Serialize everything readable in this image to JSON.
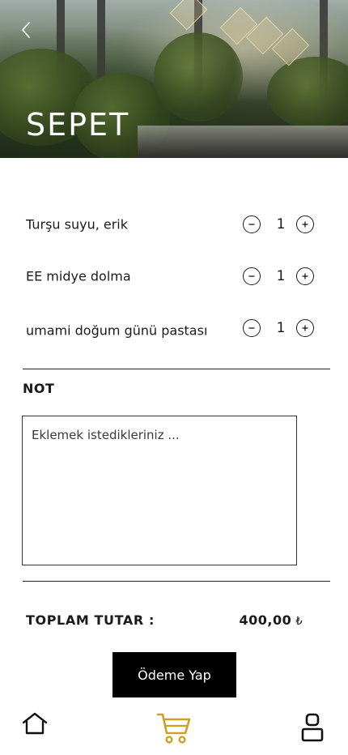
{
  "header": {
    "title": "SEPET"
  },
  "cart": {
    "items": [
      {
        "name": "Turşu suyu, erik",
        "quantity": "1"
      },
      {
        "name": "EE midye dolma",
        "quantity": "1"
      },
      {
        "name": "umami doğum günü pastası",
        "quantity": "1"
      }
    ]
  },
  "note": {
    "label": "NOT",
    "placeholder": "Eklemek istedikleriniz ...",
    "value": ""
  },
  "total": {
    "label": "TOPLAM TUTAR :",
    "amount": "400,00",
    "currency": "₺"
  },
  "actions": {
    "pay_label": "Ödeme Yap"
  },
  "bottom_nav": {
    "items": [
      {
        "icon": "home-icon",
        "active": false
      },
      {
        "icon": "cart-icon",
        "active": true
      },
      {
        "icon": "user-icon",
        "active": false
      }
    ],
    "active_color": "#c9a227",
    "inactive_color": "#111111"
  }
}
